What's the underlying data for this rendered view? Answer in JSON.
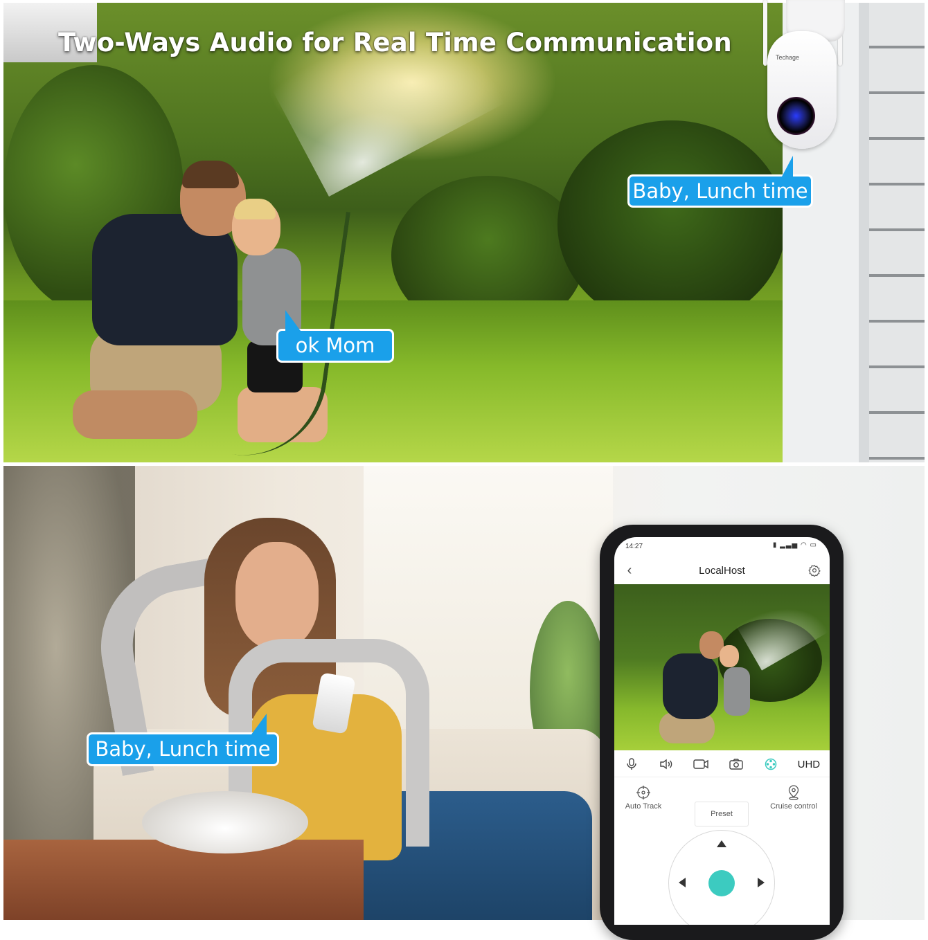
{
  "headline": "Two-Ways Audio for Real Time Communication",
  "camera": {
    "brand": "Techage"
  },
  "bubbles": {
    "camera_speech": "Baby, Lunch time",
    "kid_reply": "ok Mom",
    "mom_speech": "Baby, Lunch time"
  },
  "phone_app": {
    "status_time": "14:27",
    "title": "LocalHost",
    "toolbar": {
      "mic_icon": "microphone-icon",
      "speaker_icon": "speaker-icon",
      "record_icon": "video-record-icon",
      "snapshot_icon": "camera-icon",
      "ptz_icon": "ptz-icon",
      "quality_label": "UHD"
    },
    "ptz": {
      "auto_track_label": "Auto Track",
      "preset_label": "Preset",
      "cruise_label": "Cruise control"
    },
    "accent_color": "#3ccbc0"
  },
  "colors": {
    "bubble_blue": "#1aa0ea"
  }
}
